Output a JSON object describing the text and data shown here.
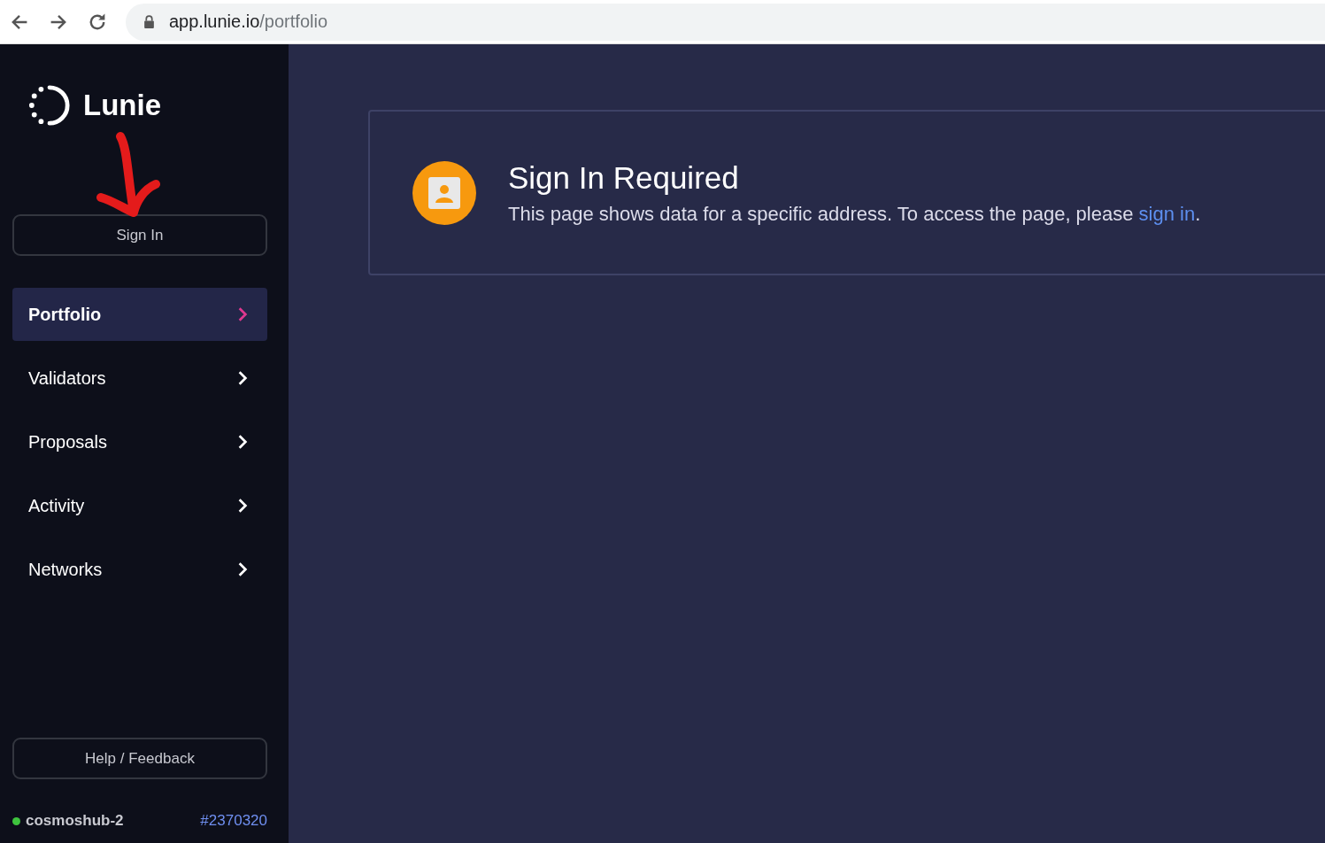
{
  "browser": {
    "url_host": "app.lunie.io",
    "url_path": "/portfolio"
  },
  "sidebar": {
    "logo_text": "Lunie",
    "sign_in_button": "Sign In",
    "nav_items": [
      {
        "label": "Portfolio",
        "selected": true
      },
      {
        "label": "Validators",
        "selected": false
      },
      {
        "label": "Proposals",
        "selected": false
      },
      {
        "label": "Activity",
        "selected": false
      },
      {
        "label": "Networks",
        "selected": false
      }
    ],
    "help_button": "Help / Feedback",
    "network": {
      "name": "cosmoshub-2",
      "color": "#3ec33e",
      "block": "#2370320"
    }
  },
  "annotation": {
    "kind": "arrow"
  },
  "notice": {
    "title": "Sign In Required",
    "text_before": "This page shows data for a specific address. To access the page, please ",
    "link": "sign in",
    "text_after": "."
  }
}
